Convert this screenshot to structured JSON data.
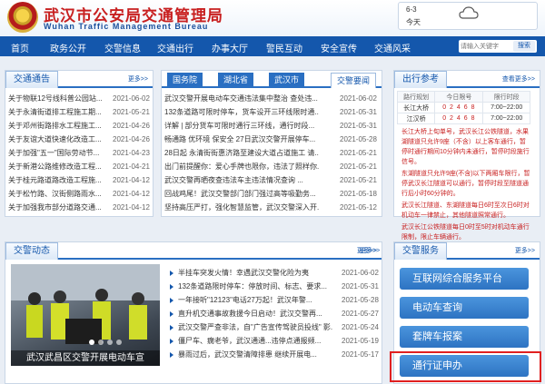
{
  "header": {
    "title_cn": "武汉市公安局交通管理局",
    "title_en": "Wuhan Traffic Management Bureau",
    "weather_date": "6-3",
    "weather_day": "今天",
    "weather_icon": "cloud-icon"
  },
  "nav": {
    "items": [
      "首页",
      "政务公开",
      "交警信息",
      "交通出行",
      "办事大厅",
      "警民互动",
      "安全宣传",
      "交通风采"
    ],
    "search_placeholder": "请输入关键字",
    "search_button": "搜索"
  },
  "notices": {
    "title": "交通通告",
    "more": "更多>>",
    "items": [
      {
        "t": "关于物联12号线科普公园站...",
        "d": "2021-06-02"
      },
      {
        "t": "关于永清街道排工程施工期...",
        "d": "2021-05-21"
      },
      {
        "t": "关于邓州街路排水工程施工...",
        "d": "2021-04-26"
      },
      {
        "t": "关于友谊大道快速化改造工...",
        "d": "2021-04-26"
      },
      {
        "t": "关于加强\"五一\"国际劳动节...",
        "d": "2021-04-23"
      },
      {
        "t": "关于新港公路维修改造工程...",
        "d": "2021-04-21"
      },
      {
        "t": "关于桂元路道路改造工程施...",
        "d": "2021-04-12"
      },
      {
        "t": "关于松竹路、汉街侧路雨水...",
        "d": "2021-04-12"
      },
      {
        "t": "关于加强我市部分道路交通...",
        "d": "2021-04-12"
      }
    ]
  },
  "mid": {
    "tabs": [
      "国务院",
      "湖北省",
      "武汉市",
      "交警要闻"
    ],
    "more": "更多>>",
    "items": [
      {
        "t": "武汉交警开展电动车交通违法集中整治 查处违...",
        "d": "2021-06-02"
      },
      {
        "t": "132条道路可限时停车，货车设开三环线限时通...",
        "d": "2021-05-31"
      },
      {
        "t": "详解 | 部分货车可限时通行三环线，通行时段...",
        "d": "2021-05-31"
      },
      {
        "t": "畅通路 优环境 保安全 27日武汉交警开展停车...",
        "d": "2021-05-28"
      },
      {
        "t": "28日起 永清街街惠济路至建设大道占道施工 请...",
        "d": "2021-05-21"
      },
      {
        "t": "出门前提醒你：爱心手牌也限你，违法了照样你...",
        "d": "2021-05-21"
      },
      {
        "t": "武汉交警再晒夜查违法车主违法情况查询 ...",
        "d": "2021-05-21"
      },
      {
        "t": "回战鸡尾！武汉交警部门部门强过高等吸勤务...",
        "d": "2021-05-18"
      },
      {
        "t": "坚持高压严打，强化智慧监管，武汉交警深入开...",
        "d": "2021-05-12"
      }
    ]
  },
  "travel": {
    "title": "出行参考",
    "more": "查看更多>>",
    "headers": [
      "路行规划",
      "今日限号",
      "限行时段"
    ],
    "rows": [
      {
        "name": "长江大桥",
        "num": "0 2 4 6 8",
        "time": "7:00~22:00"
      },
      {
        "name": "江汉桥",
        "num": "0 2 4 6 8",
        "time": "7:00~22:00"
      }
    ],
    "desc": [
      "长江大桥上旬单号，武汉长江公铁隧道，水果湖隧道只允许9座（不含）以上客车通行，暂停时通行期间10分钟内未通行，暂停时段施行信号。",
      "东湖隧道只允许9座(不含)以下两厢车限行，暂停武汉长江隧道可以通行，暂停时段至隧道通行后小时60分钟的。",
      "武汉长江隧道、东湖隧道每日6时至次日6时对机动车一律禁止，其他隧道照常通行。",
      "武汉长江公铁隧道每日0时至5时对机动车通行限制，限止车辆通行。"
    ]
  },
  "photos": {
    "title": "交警动态",
    "more": "更多>>",
    "caption": "武汉武昌区交警开展电动车宣"
  },
  "news": {
    "more": "更多>>",
    "items": [
      {
        "t": "半挂车突发火情！幸遇武汉交警化险为夷",
        "d": "2021-06-02"
      },
      {
        "t": "132条道路限时停车：停放时间、标志、要求...",
        "d": "2021-05-31"
      },
      {
        "t": "一年接听\"12123\"电话27万起！武汉年警...",
        "d": "2021-05-28"
      },
      {
        "t": "直升机交通事故救援今日启动！武汉交警再...",
        "d": "2021-05-27"
      },
      {
        "t": "武汉交警严查非法，自\"广告宣传驾驶员投线\" 影...",
        "d": "2021-05-24"
      },
      {
        "t": "僵尸车、瘸老爷，武汉通通...违停点通报频...",
        "d": "2021-05-19"
      },
      {
        "t": "暴雨过后，武汉交警清障排患 继续开展电...",
        "d": "2021-05-17"
      }
    ]
  },
  "services": {
    "title": "交警服务",
    "more": "更多>>",
    "buttons": [
      "互联网综合服务平台",
      "电动车查询",
      "套牌车报案",
      "通行证申办"
    ]
  }
}
